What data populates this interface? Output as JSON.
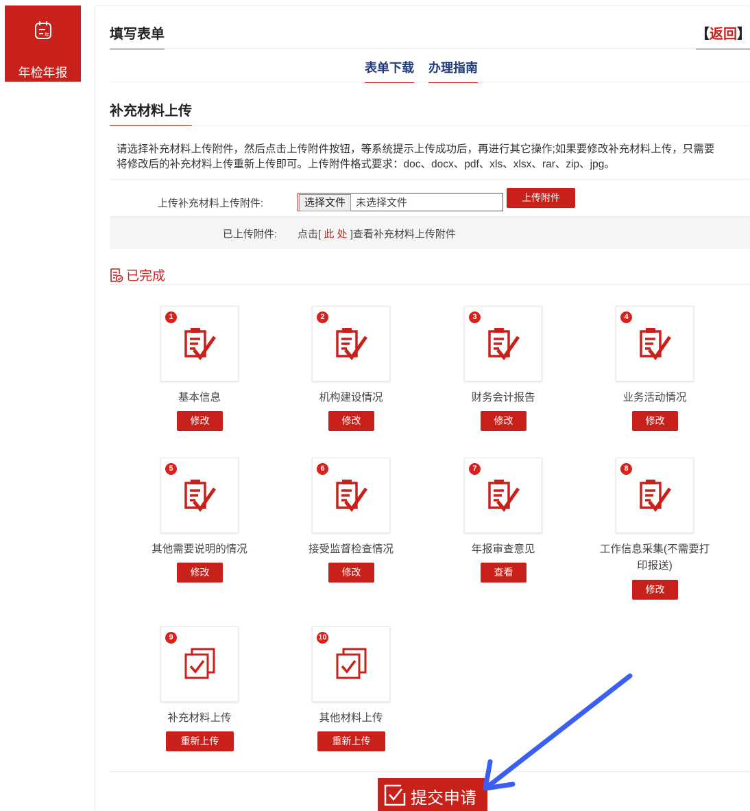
{
  "sidebar": {
    "tile_label": "年检年报",
    "tile_icon": "calendar-list-icon"
  },
  "header": {
    "title": "填写表单",
    "back_open": "【",
    "back_text": "返回",
    "back_close": "】"
  },
  "tabs": [
    {
      "label": "表单下载"
    },
    {
      "label": "办理指南"
    }
  ],
  "section": {
    "title": "补充材料上传",
    "instructions_line1": "请选择补充材料上传附件，然后点击上传附件按钮，等系统提示上传成功后，再进行其它操作;如果要修改补充材料上传，只需要",
    "instructions_line2": "将修改后的补充材料上传重新上传即可。上传附件格式要求：doc、docx、pdf、xls、xlsx、rar、zip、jpg。"
  },
  "upload": {
    "label": "上传补充材料上传附件:",
    "choose_button": "选择文件",
    "file_status": "未选择文件",
    "upload_button": "上传附件"
  },
  "uploaded": {
    "label": "已上传附件:",
    "prefix": "点击[",
    "link": " 此 处 ",
    "suffix": "]查看补充材料上传附件"
  },
  "completed": {
    "title": "已完成",
    "icon": "document-check-icon"
  },
  "items": [
    {
      "num": "1",
      "label": "基本信息",
      "action": "修改",
      "icon": "form-edit-icon"
    },
    {
      "num": "2",
      "label": "机构建设情况",
      "action": "修改",
      "icon": "form-edit-icon"
    },
    {
      "num": "3",
      "label": "财务会计报告",
      "action": "修改",
      "icon": "form-edit-icon"
    },
    {
      "num": "4",
      "label": "业务活动情况",
      "action": "修改",
      "icon": "form-edit-icon"
    },
    {
      "num": "5",
      "label": "其他需要说明的情况",
      "action": "修改",
      "icon": "form-edit-icon"
    },
    {
      "num": "6",
      "label": "接受监督检查情况",
      "action": "修改",
      "icon": "form-edit-icon"
    },
    {
      "num": "7",
      "label": "年报审查意见",
      "action": "查看",
      "icon": "form-edit-icon"
    },
    {
      "num": "8",
      "label": "工作信息采集(不需要打印报送)",
      "label_line1": "工作信息采集(不需要打",
      "label_line2": "印报送)",
      "action": "修改",
      "icon": "form-edit-icon"
    },
    {
      "num": "9",
      "label": "补充材料上传",
      "action": "重新上传",
      "icon": "stacked-check-icon"
    },
    {
      "num": "10",
      "label": "其他材料上传",
      "action": "重新上传",
      "icon": "stacked-check-icon"
    }
  ],
  "submit": {
    "label": "提交申请",
    "icon": "checkbox-edit-icon"
  },
  "colors": {
    "brand_red": "#c8201a",
    "tab_blue": "#1f3a7a",
    "annotation_arrow": "#3b5ff2"
  }
}
